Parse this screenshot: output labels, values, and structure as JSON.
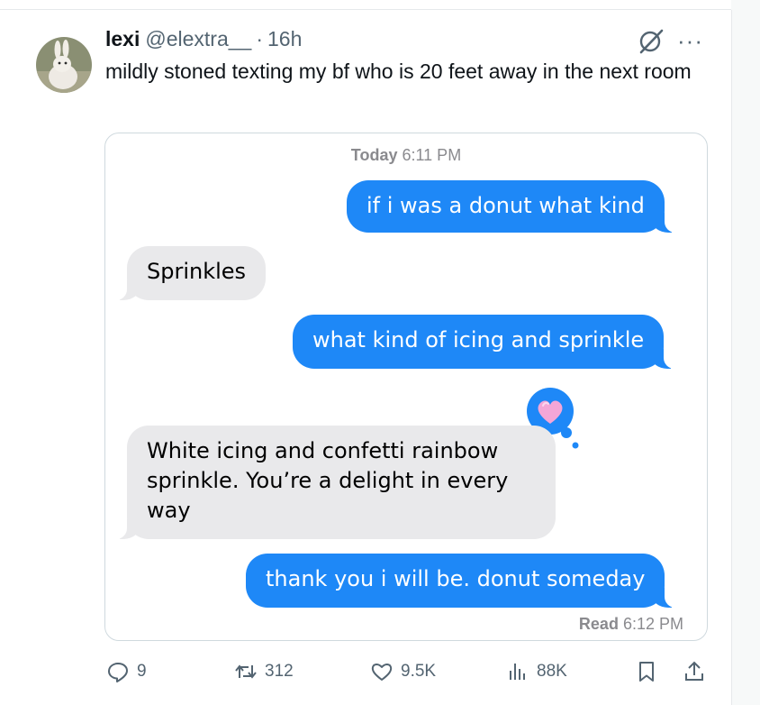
{
  "tweet": {
    "display_name": "lexi",
    "handle": "@elextra__",
    "separator": "·",
    "time": "16h",
    "text": "mildly stoned texting my bf who is 20 feet away in the next room"
  },
  "conversation": {
    "timestamp_label": "Today",
    "timestamp_time": "6:11 PM",
    "messages": [
      {
        "from": "me",
        "text": "if i was a donut what kind"
      },
      {
        "from": "them",
        "text": "Sprinkles"
      },
      {
        "from": "me",
        "text": "what kind of icing and sprinkle"
      },
      {
        "from": "them",
        "text": "White icing and confetti rainbow sprinkle. You’re a delight in every way"
      },
      {
        "from": "me",
        "text": "thank you i will be. donut someday"
      }
    ],
    "read_label": "Read",
    "read_time": "6:12 PM",
    "tapback_icon": "heart-icon"
  },
  "actions": {
    "replies": "9",
    "reposts": "312",
    "likes": "9.5K",
    "views": "88K"
  },
  "colors": {
    "imessage_blue": "#1e88f7",
    "incoming_gray": "#e9e9eb",
    "muted_text": "#536471"
  }
}
